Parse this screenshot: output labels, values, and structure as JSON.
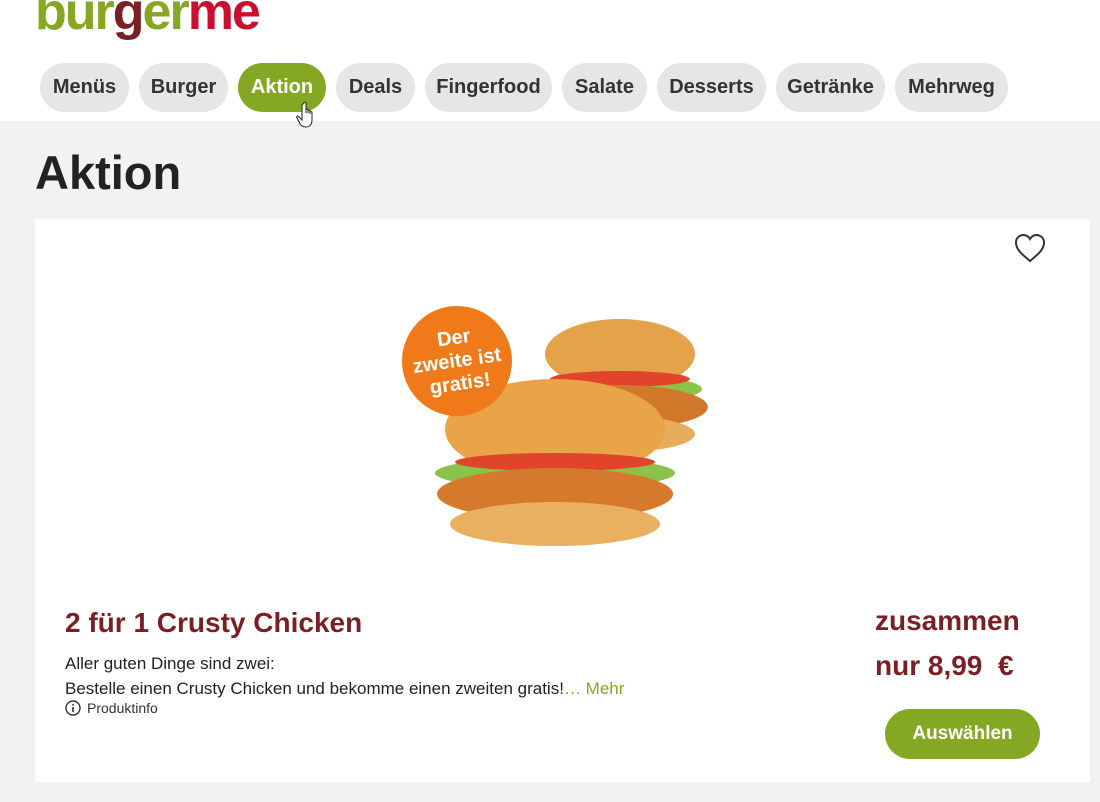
{
  "brand": {
    "logo_parts": [
      {
        "text": "bur",
        "color": "#84a823"
      },
      {
        "text": "g",
        "color": "#7a1f23"
      },
      {
        "text": "er",
        "color": "#84a823"
      },
      {
        "text": "me",
        "color": "#c8102e"
      }
    ]
  },
  "nav": {
    "active_index": 2,
    "tabs": [
      {
        "label": "Menüs"
      },
      {
        "label": "Burger"
      },
      {
        "label": "Aktion"
      },
      {
        "label": "Deals"
      },
      {
        "label": "Fingerfood"
      },
      {
        "label": "Salate"
      },
      {
        "label": "Desserts"
      },
      {
        "label": "Getränke"
      },
      {
        "label": "Mehrweg"
      }
    ]
  },
  "page": {
    "title": "Aktion"
  },
  "product": {
    "badge_lines": [
      "Der",
      "zweite ist",
      "gratis!"
    ],
    "title": "2 für 1 Crusty Chicken",
    "description_line1": "Aller guten Dinge sind zwei:",
    "description_line2": "Bestelle einen Crusty Chicken und bekomme einen zweiten gratis!",
    "more_link": "… Mehr",
    "info_label": "Produktinfo",
    "price_label": "zusammen",
    "price": "nur 8,99  €",
    "select_button": "Auswählen",
    "favorite_icon": "heart-outline-icon"
  },
  "colors": {
    "accent_green": "#84a823",
    "price_red": "#7a1f23",
    "badge_orange": "#f07a1a"
  }
}
